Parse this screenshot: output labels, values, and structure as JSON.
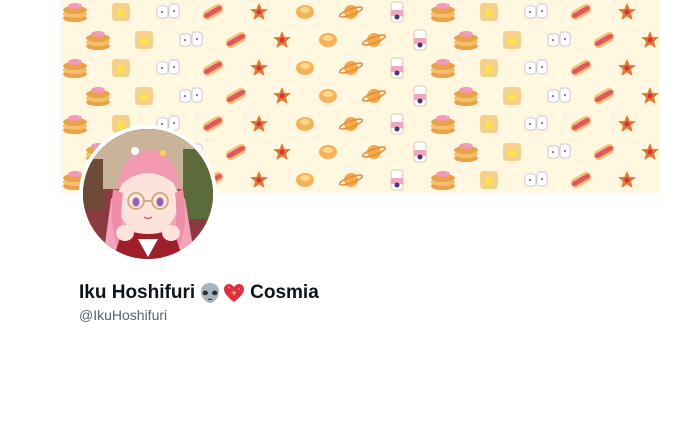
{
  "profile": {
    "display_name_first": "Iku Hoshifuri",
    "display_name_last": "Cosmia",
    "handle": "@IkuHoshifuri",
    "name_emojis": [
      "alien-icon",
      "sparkling-heart-icon"
    ]
  },
  "banner": {
    "background_color": "#fff7df",
    "pattern_icons": [
      "pancake-icon",
      "hotdog-icon",
      "planet-icon",
      "toast-icon",
      "star-cookie-icon",
      "milk-bottle-icon",
      "cat-mug-icon",
      "cream-puff-icon"
    ]
  },
  "avatar": {
    "description_icon": "vtuber-avatar-icon"
  },
  "colors": {
    "name_text": "#0f1419",
    "handle_text": "#536471",
    "page_background": "#ffffff"
  }
}
